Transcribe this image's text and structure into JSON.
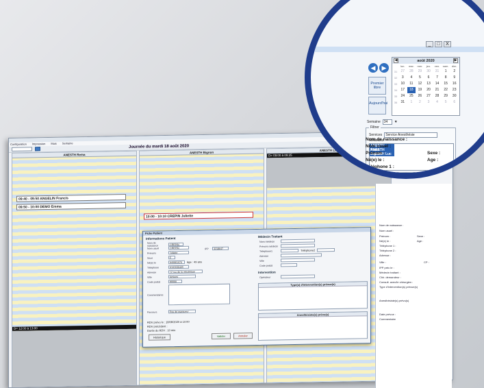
{
  "app": {
    "menu": [
      "Configuration",
      "Impression",
      "Mois",
      "Semaine"
    ],
    "day_title": "Journée du mardi 18 août 2020"
  },
  "columns": [
    {
      "name": "ANESTH Rema"
    },
    {
      "name": "ANESTH Bignon"
    },
    {
      "name": "ANESTH Luc"
    }
  ],
  "appointments": {
    "col1_a": "09:40 - 09:50 ANGELIN Francis",
    "col1_b": "09:50 - 10:00 DEMO Emma",
    "col2_a": "10:00 - 10:10 CREPIN Juliette",
    "col3_block": "D= 09:00 à 09:35",
    "col1_block": "D= 12:00 à 13:00"
  },
  "modal": {
    "title": "Fiche Patient",
    "sec_patient": "Informations Patient",
    "sec_medecin": "Médecin Traitant",
    "sec_intervention": "Intervention",
    "type_intervention": "Type(s) d'intervention(s) prévue(s)",
    "anesthesiste": "Anesthésiste(s) prévu(s)",
    "fields": [
      {
        "label": "Nom de naissance",
        "value": "CREPIN"
      },
      {
        "label": "Nom usuel",
        "value": "CREPIN"
      },
      {
        "label": "Prénom",
        "value": "Juliette"
      },
      {
        "label": "Sexe",
        "value": "F"
      },
      {
        "label": "Né(e) le",
        "value": "04/08/1970"
      },
      {
        "label": "Téléphone",
        "value": "0102030405"
      },
      {
        "label": "Adresse",
        "value": "12 rue de la république"
      },
      {
        "label": "Ville",
        "value": "Amiens"
      },
      {
        "label": "Code postal",
        "value": "80000"
      }
    ],
    "ipp_label": "IPP",
    "ipp_value": "3218647",
    "age": "âge : 49 ans",
    "commentaire": "Commentaires",
    "parcours_label": "Parcours",
    "parcours_value": "Pas de marqueur",
    "medecin_fields": [
      "Nom médecin",
      "Prénom médecin",
      "Téléphone1",
      "Adresse",
      "Ville",
      "Code postal"
    ],
    "telephone2": "Téléphone2",
    "operateur": "Opérateur",
    "rdv_info1": "RDV prévu le : 18/08/2020 à 10:00",
    "rdv_info2": "RDV précédent :",
    "rdv_info3": "Durée du RDV : 10 min",
    "historique": "Historique",
    "valider": "Valider",
    "annuler": "Annuler"
  },
  "side_panel": {
    "labels": [
      "Nom de naissance :",
      "Nom usuel :",
      "Prénom :",
      "Né(e) le :",
      "Téléphone 1 :",
      "Téléphone 2 :",
      "Adresse :",
      "Ville :",
      "IPP préc le :",
      "Médecin traitant :",
      "Chir. demandeur :",
      "Consult. avec/le chirurgien :",
      "Type d'intervention(s) prévue(s)",
      "Anesthésiste(s) prévu(s)",
      "Date prévue :",
      "Commentaire"
    ],
    "sexe": "Sexe :",
    "age": "Age :",
    "cp": "CP :"
  },
  "zoom": {
    "window_buttons": [
      "_",
      "□",
      "X"
    ],
    "prev_icon": "arrow-left-icon",
    "next_icon": "arrow-right-icon",
    "premier_btn": "Premier libre",
    "today_btn": "Aujourd'hui",
    "calendar": {
      "month": "août 2020",
      "days_of_week": [
        "lun.",
        "mar.",
        "mer.",
        "jeu.",
        "ven.",
        "sam.",
        "dim."
      ],
      "weeks": [
        {
          "wn": "31",
          "days": [
            "27",
            "28",
            "29",
            "30",
            "31",
            "1",
            "2"
          ],
          "dim": [
            0,
            1,
            2,
            3,
            4
          ]
        },
        {
          "wn": "32",
          "days": [
            "3",
            "4",
            "5",
            "6",
            "7",
            "8",
            "9"
          ],
          "dim": []
        },
        {
          "wn": "33",
          "days": [
            "10",
            "11",
            "12",
            "13",
            "14",
            "15",
            "16"
          ],
          "dim": []
        },
        {
          "wn": "34",
          "days": [
            "17",
            "18",
            "19",
            "20",
            "21",
            "22",
            "23"
          ],
          "dim": [],
          "sel": 1
        },
        {
          "wn": "35",
          "days": [
            "24",
            "25",
            "26",
            "27",
            "28",
            "29",
            "30"
          ],
          "dim": []
        },
        {
          "wn": "36",
          "days": [
            "31",
            "1",
            "2",
            "3",
            "4",
            "5",
            "6"
          ],
          "dim": [
            1,
            2,
            3,
            4,
            5,
            6
          ]
        }
      ]
    },
    "semaine_label": "Semaine",
    "semaine_value": "34",
    "filtrer_label": "Filtrer",
    "services_label": "Services",
    "services_value": "Service Anesthésie",
    "medecins_label": "Médecins",
    "medecins": [
      "ANESTH Rema",
      "ANESTH Bignon",
      "ANESTH Luc"
    ],
    "nom_naissance": "Nom de naissance :",
    "nom_usuel": "Nom usuel :",
    "prenom": "Prénom :",
    "sexe": "Sexe :",
    "ne_le": "Né(e) le :",
    "age": "Age :",
    "telephone1": "Téléphone 1 :"
  },
  "colors": {
    "ring": "#1f3c8b",
    "accent": "#2a62b3",
    "stripe_blue": "#cfe0f4",
    "stripe_yellow": "#f9f2c0"
  }
}
